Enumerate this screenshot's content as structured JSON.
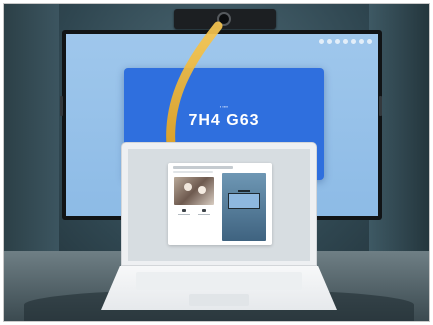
{
  "display": {
    "code": "7H4 G63"
  },
  "icons": {
    "camera": "camera-icon",
    "arrow": "curved-arrow-icon",
    "status": "status-icons"
  },
  "colors": {
    "screen_bg": "#9fc7ec",
    "code_card": "#2f6fde",
    "arrow": "#f2b21b",
    "laptop": "#eef0f2"
  }
}
